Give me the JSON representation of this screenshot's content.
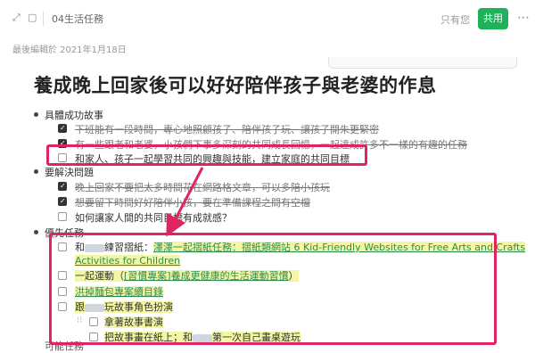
{
  "topbar": {
    "notebook_name": "04生活任務",
    "readonly_label": "只有您",
    "share_label": "共用",
    "more_icon": "more-horizontal-icon"
  },
  "note": {
    "last_edited": "最後編輯於 2021年1月18日",
    "title": "養成晚上回家後可以好好陪伴孩子與老婆的作息"
  },
  "sections": {
    "s1_label": "具體成功故事",
    "s1_items": [
      "下班能有一段時間，專心地照顧孩子、陪伴孩子玩、讓孩子開朱更緊密",
      "有一些跟老和老婆，小孩們下事多深刻的共同成長回憶，一起達成許多不一樣的有趣的任務",
      "和家人、孩子一起學習共同的興趣與技能，建立家庭的共同目標"
    ],
    "s2_label": "要解決問題",
    "s2_items": [
      "晚上回家不要把太多時間花在網路格文章，可以多陪小孩玩",
      "想要留下時間好好陪伴小孩，要在準備課程之間有空檔",
      "如何讓家人間的共同目標有成就感？"
    ],
    "s3_label": "優先任務",
    "s3_item1_pre": "和",
    "s3_item1_mid": "練習摺紙：",
    "s3_item1_link": "澤澤一起摺紙任務：摺紙類網站 6 Kid-Friendly Websites for Free Arts and Crafts",
    "s3_item1_cont": "Activities for Children",
    "s3_item2_pre": "一起運動（",
    "s3_item2_link": "[習慣專案]養成更健康的生活運動習慣",
    "s3_item2_post": "）",
    "s3_item3": "洪掉麵包專案續目錄",
    "s3_item4_pre": "跟",
    "s3_item4_post": "玩故事角色扮演",
    "s3_sub1": "拿著故事書演",
    "s3_sub2_pre": "把故事畫在紙上；和",
    "s3_sub2_post": "第一次自己畫桌遊玩",
    "s4_label": "可能任務"
  },
  "colors": {
    "accent_green": "#1fb25a",
    "annotation_red": "#e0245e",
    "highlight_yellow": "#f3f7a3"
  }
}
